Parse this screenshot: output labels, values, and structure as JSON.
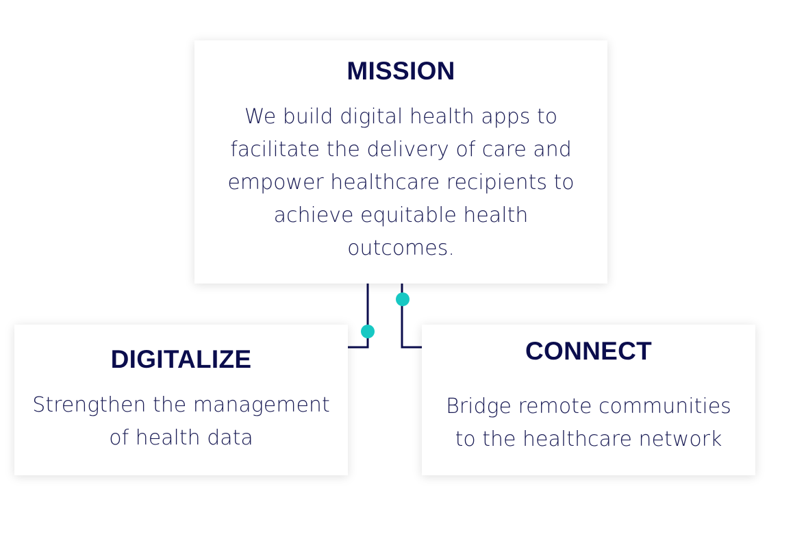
{
  "colors": {
    "line": "#0b0d4d",
    "dot": "#17c8c3",
    "heading": "#0b0d4d",
    "text": "#1a1c55"
  },
  "mission": {
    "title": "MISSION",
    "text": "We build digital health apps to facilitate the delivery of care and empower healthcare recipients to achieve equitable health outcomes."
  },
  "digitalize": {
    "title": "DIGITALIZE",
    "text": "Strengthen the management of health data"
  },
  "connect": {
    "title": "CONNECT",
    "text": "Bridge remote communities to the healthcare network"
  }
}
